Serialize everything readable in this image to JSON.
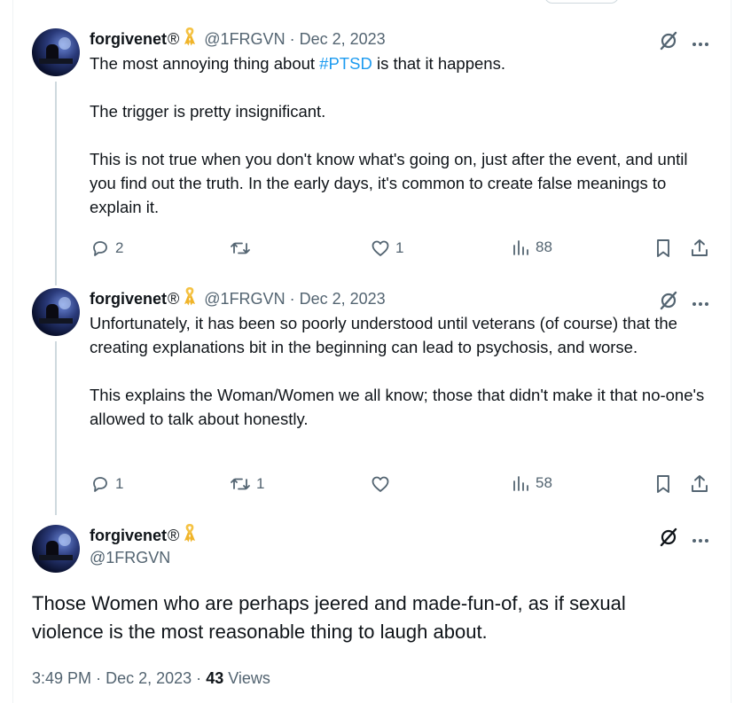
{
  "colors": {
    "link": "#1d9bf0",
    "secondary": "#536471",
    "text": "#0f1419",
    "ribbon": "#f5c243",
    "line": "#cfd9de"
  },
  "tweets": [
    {
      "name": "forgivenet",
      "reg": "®",
      "handle": "@1FRGVN",
      "sep": "·",
      "date": "Dec 2, 2023",
      "text_pre": "The most annoying thing about ",
      "hashtag": "#PTSD",
      "text_post": " is that it happens.",
      "p2": "The trigger is pretty insignificant.",
      "p3": "This is not true when you don't know what's going on, just after the event, and until you find out the truth. In the early days, it's common to create false meanings to explain it.",
      "replies": "2",
      "retweets": "",
      "likes": "1",
      "views": "88"
    },
    {
      "name": "forgivenet",
      "reg": "®",
      "handle": "@1FRGVN",
      "sep": "·",
      "date": "Dec 2, 2023",
      "p1": "Unfortunately, it has been so poorly understood until veterans (of course) that the creating explanations bit in the beginning can lead to psychosis, and worse.",
      "p2": "This explains the Woman/Women we all know; those that didn't make it that no-one's allowed to talk about honestly.",
      "replies": "1",
      "retweets": "1",
      "likes": "",
      "views": "58"
    },
    {
      "name": "forgivenet",
      "reg": "®",
      "handle": "@1FRGVN",
      "text": "Those Women who are perhaps jeered and made-fun-of, as if sexual violence is the most reasonable thing to laugh about.",
      "time": "3:49 PM",
      "sep": "·",
      "date": "Dec 2, 2023",
      "sep2": "·",
      "views_count": "43",
      "views_label": "Views"
    }
  ],
  "icons": [
    "grok-icon",
    "more-icon",
    "reply-icon",
    "retweet-icon",
    "like-icon",
    "views-icon",
    "bookmark-icon",
    "share-icon",
    "ribbon-icon"
  ]
}
